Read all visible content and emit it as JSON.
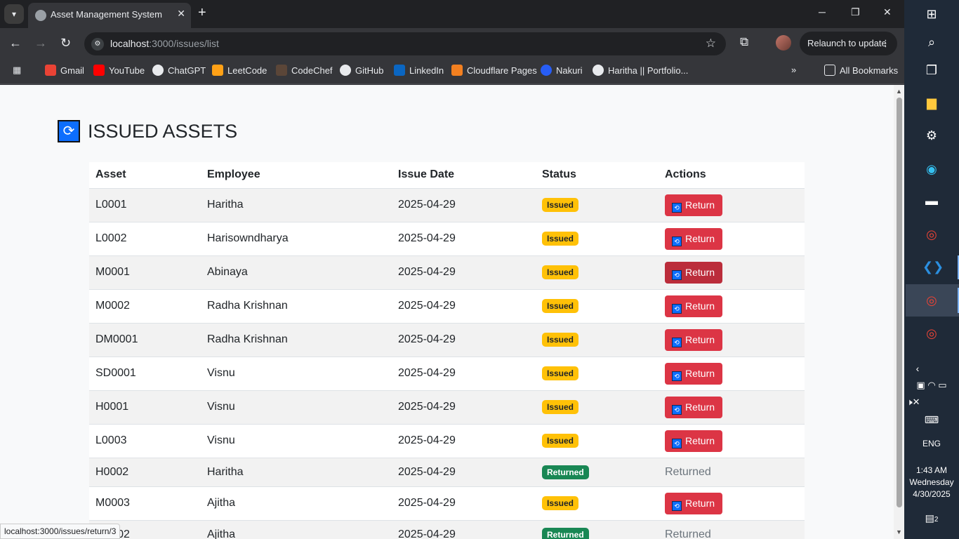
{
  "browser": {
    "tab_title": "Asset Management System",
    "url_host": "localhost",
    "url_path": ":3000/issues/list",
    "relaunch_label": "Relaunch to update",
    "bookmarks": [
      "Gmail",
      "YouTube",
      "ChatGPT",
      "LeetCode",
      "CodeChef",
      "GitHub",
      "LinkedIn",
      "Cloudflare Pages",
      "Nakuri",
      "Haritha || Portfolio..."
    ],
    "all_bookmarks": "All Bookmarks",
    "status_url": "localhost:3000/issues/return/3"
  },
  "page": {
    "title": "ISSUED ASSETS",
    "columns": [
      "Asset",
      "Employee",
      "Issue Date",
      "Status",
      "Actions"
    ],
    "return_label": "Return",
    "returned_label": "Returned",
    "rows": [
      {
        "asset": "L0001",
        "employee": "Haritha",
        "date": "2025-04-29",
        "status": "Issued"
      },
      {
        "asset": "L0002",
        "employee": "Harisowndharya",
        "date": "2025-04-29",
        "status": "Issued"
      },
      {
        "asset": "M0001",
        "employee": "Abinaya",
        "date": "2025-04-29",
        "status": "Issued"
      },
      {
        "asset": "M0002",
        "employee": "Radha Krishnan",
        "date": "2025-04-29",
        "status": "Issued"
      },
      {
        "asset": "DM0001",
        "employee": "Radha Krishnan",
        "date": "2025-04-29",
        "status": "Issued"
      },
      {
        "asset": "SD0001",
        "employee": "Visnu",
        "date": "2025-04-29",
        "status": "Issued"
      },
      {
        "asset": "H0001",
        "employee": "Visnu",
        "date": "2025-04-29",
        "status": "Issued"
      },
      {
        "asset": "L0003",
        "employee": "Visnu",
        "date": "2025-04-29",
        "status": "Issued"
      },
      {
        "asset": "H0002",
        "employee": "Haritha",
        "date": "2025-04-29",
        "status": "Returned"
      },
      {
        "asset": "M0003",
        "employee": "Ajitha",
        "date": "2025-04-29",
        "status": "Issued"
      },
      {
        "asset": "M0002",
        "employee": "Ajitha",
        "date": "2025-04-29",
        "status": "Returned"
      }
    ]
  },
  "taskbar": {
    "language": "ENG",
    "time": "1:43 AM",
    "day": "Wednesday",
    "date": "4/30/2025",
    "notifications": "2"
  }
}
